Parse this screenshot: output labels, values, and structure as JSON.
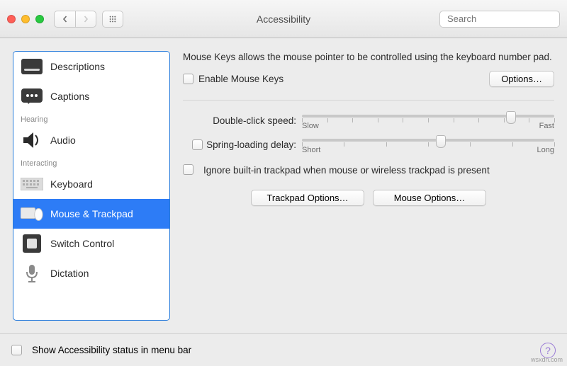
{
  "window": {
    "title": "Accessibility",
    "search_placeholder": "Search"
  },
  "sidebar": {
    "headings": {
      "hearing": "Hearing",
      "interacting": "Interacting"
    },
    "items": {
      "descriptions": "Descriptions",
      "captions": "Captions",
      "audio": "Audio",
      "keyboard": "Keyboard",
      "mouse_trackpad": "Mouse & Trackpad",
      "switch_control": "Switch Control",
      "dictation": "Dictation"
    }
  },
  "detail": {
    "description": "Mouse Keys allows the mouse pointer to be controlled using the keyboard number pad.",
    "enable_label": "Enable Mouse Keys",
    "options_btn": "Options…",
    "dbl_click": {
      "label": "Double-click speed:",
      "min": "Slow",
      "max": "Fast",
      "value_pct": 83
    },
    "spring": {
      "label": "Spring-loading delay:",
      "min": "Short",
      "max": "Long",
      "value_pct": 55
    },
    "ignore_label": "Ignore built-in trackpad when mouse or wireless trackpad is present",
    "trackpad_options_btn": "Trackpad Options…",
    "mouse_options_btn": "Mouse Options…"
  },
  "footer": {
    "show_status_label": "Show Accessibility status in menu bar",
    "help": "?"
  },
  "watermark": "wsxdn.com"
}
